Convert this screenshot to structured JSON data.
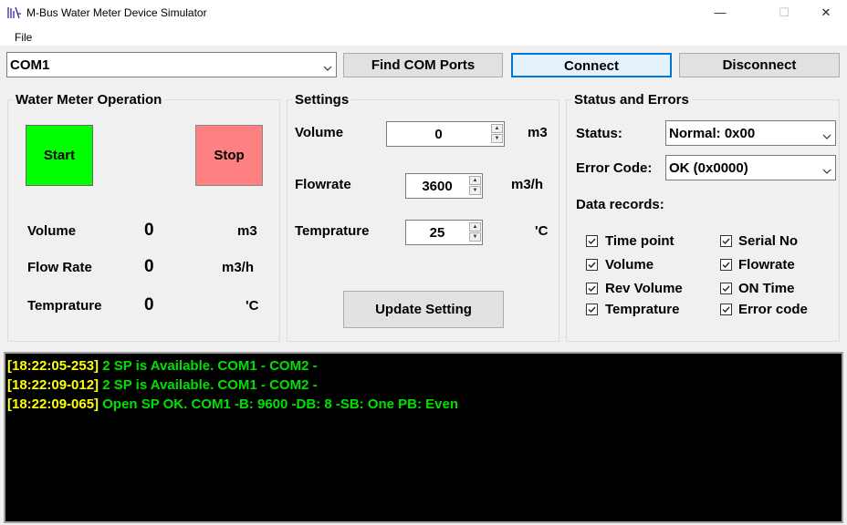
{
  "window": {
    "title": "M-Bus Water Meter Device Simulator",
    "minimize_glyph": "—",
    "maximize_glyph": "☐",
    "close_glyph": "✕"
  },
  "menu": {
    "file": "File"
  },
  "toolbar": {
    "port_selected": "COM1",
    "find_ports": "Find COM Ports",
    "connect": "Connect",
    "disconnect": "Disconnect"
  },
  "operation": {
    "title": "Water Meter Operation",
    "start": "Start",
    "stop": "Stop",
    "start_color": "#00ff00",
    "stop_color": "#ff8080",
    "rows": [
      {
        "label": "Volume",
        "value": "0",
        "unit": "m3"
      },
      {
        "label": "Flow Rate",
        "value": "0",
        "unit": "m3/h"
      },
      {
        "label": "Temprature",
        "value": "0",
        "unit": "'C"
      }
    ]
  },
  "settings": {
    "title": "Settings",
    "volume_label": "Volume",
    "volume_value": "0",
    "volume_unit": "m3",
    "flowrate_label": "Flowrate",
    "flowrate_value": "3600",
    "flowrate_unit": "m3/h",
    "temp_label": "Temprature",
    "temp_value": "25",
    "temp_unit": "'C",
    "update": "Update Setting"
  },
  "status": {
    "title": "Status and Errors",
    "status_label": "Status:",
    "status_value": "Normal: 0x00",
    "error_label": "Error Code:",
    "error_value": "OK (0x0000)",
    "records_label": "Data records:",
    "records": [
      {
        "label": "Time point",
        "checked": true
      },
      {
        "label": "Serial No",
        "checked": true
      },
      {
        "label": "Volume",
        "checked": true
      },
      {
        "label": "Flowrate",
        "checked": true
      },
      {
        "label": "Rev Volume",
        "checked": true
      },
      {
        "label": "ON Time",
        "checked": true
      },
      {
        "label": "Temprature",
        "checked": true
      },
      {
        "label": "Error code",
        "checked": true
      }
    ]
  },
  "log": [
    {
      "time": "[18:22:05-253]",
      "text": "2 SP is Available. COM1 - COM2 -"
    },
    {
      "time": "[18:22:09-012]",
      "text": "2 SP is Available. COM1 - COM2 -"
    },
    {
      "time": "[18:22:09-065]",
      "text": "Open SP OK. COM1 -B: 9600 -DB: 8 -SB: One PB: Even"
    }
  ],
  "colors": {
    "log_timestamp": "#ffff00",
    "log_message": "#00e000",
    "focus_border": "#0078d7"
  }
}
